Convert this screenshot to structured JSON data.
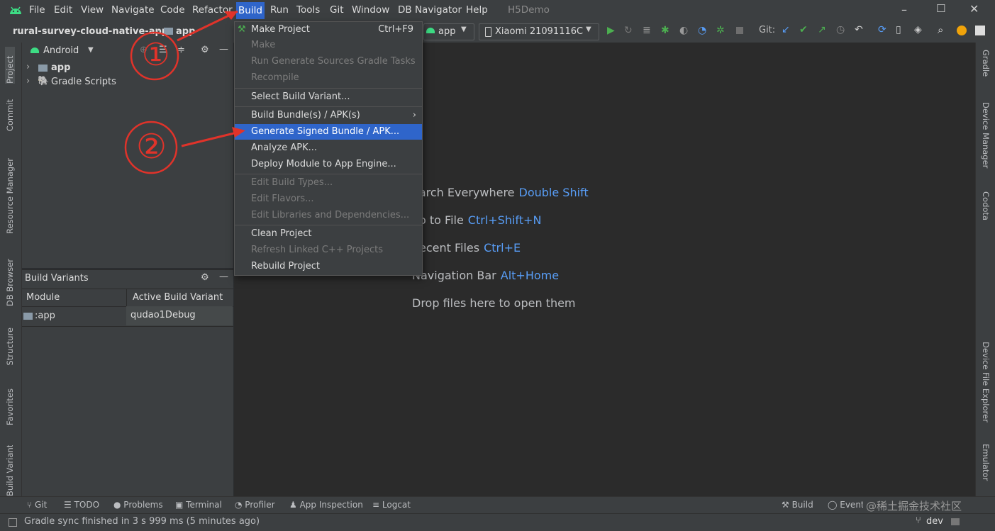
{
  "menubar": {
    "items": [
      "File",
      "Edit",
      "View",
      "Navigate",
      "Code",
      "Refactor",
      "Build",
      "Run",
      "Tools",
      "Git",
      "Window",
      "DB Navigator",
      "Help"
    ],
    "project_title": "H5Demo"
  },
  "navbar": {
    "breadcrumb_project": "rural-survey-cloud-native-app",
    "breadcrumb_module": "app",
    "run_config": "app",
    "device": "Xiaomi 21091116C",
    "git_label": "Git:"
  },
  "project_panel": {
    "view_mode": "Android",
    "tree": [
      "app",
      "Gradle Scripts"
    ]
  },
  "build_variants": {
    "title": "Build Variants",
    "col_module": "Module",
    "col_variant": "Active Build Variant",
    "row_module": ":app",
    "row_variant": "qudao1Debug"
  },
  "left_tools": [
    "Project",
    "Commit",
    "Resource Manager",
    "DB Browser",
    "Structure",
    "Favorites",
    "Build Variants"
  ],
  "right_tools": [
    "Gradle",
    "Device Manager",
    "Codota",
    "Device File Explorer",
    "Emulator"
  ],
  "build_menu": {
    "make_project": "Make Project",
    "make_project_shortcut": "Ctrl+F9",
    "make": "Make",
    "run_generate": "Run Generate Sources Gradle Tasks",
    "recompile": "Recompile",
    "select_variant": "Select Build Variant...",
    "build_bundle": "Build Bundle(s) / APK(s)",
    "generate_signed": "Generate Signed Bundle / APK...",
    "analyze_apk": "Analyze APK...",
    "deploy_module": "Deploy Module to App Engine...",
    "edit_build_types": "Edit Build Types...",
    "edit_flavors": "Edit Flavors...",
    "edit_libraries": "Edit Libraries and Dependencies...",
    "clean_project": "Clean Project",
    "refresh_linked": "Refresh Linked C++ Projects",
    "rebuild_project": "Rebuild Project"
  },
  "editor_hints": [
    {
      "label": "earch Everywhere",
      "key": "Double Shift"
    },
    {
      "label": "o to File",
      "key": "Ctrl+Shift+N"
    },
    {
      "label": "ecent Files",
      "key": "Ctrl+E"
    },
    {
      "label": "Navigation Bar",
      "key": "Alt+Home"
    },
    {
      "label": "Drop files here to open them",
      "key": ""
    }
  ],
  "annotations": {
    "step1": "①",
    "step2": "②"
  },
  "bottom_tools": [
    "Git",
    "TODO",
    "Problems",
    "Terminal",
    "Profiler",
    "App Inspection",
    "Logcat"
  ],
  "bottom_right_tools": [
    "Build",
    "Event Log"
  ],
  "watermark": "@稀土掘金技术社区",
  "status": {
    "message": "Gradle sync finished in 3 s 999 ms (5 minutes ago)",
    "branch": "dev"
  },
  "colors": {
    "accent": "#2f65ca",
    "shortcut_blue": "#589df6",
    "annotation_red": "#e0332a",
    "android_green": "#3ddc84",
    "run_green": "#4caf50"
  }
}
